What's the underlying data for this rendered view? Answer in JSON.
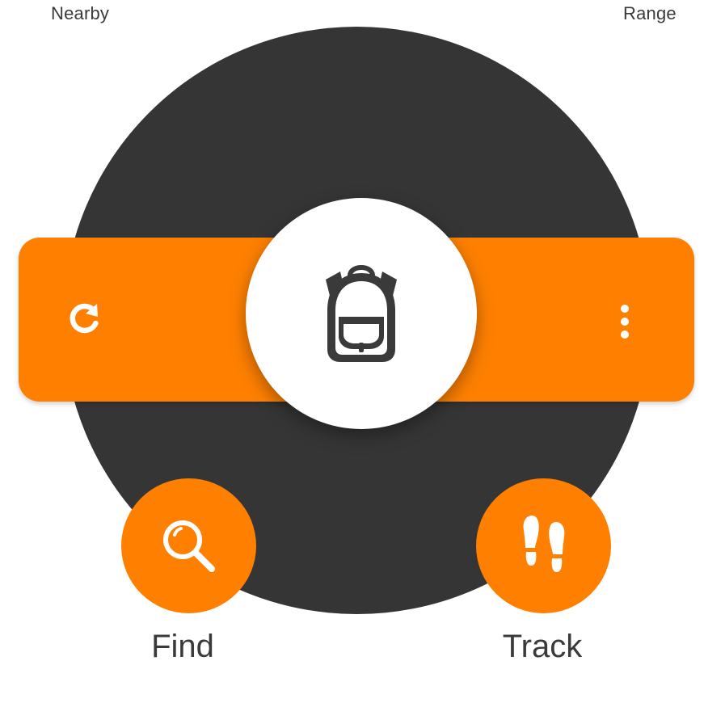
{
  "header": {
    "left_label": "Nearby",
    "right_label": "Range"
  },
  "band": {
    "left_icon": "refresh-icon",
    "right_icon": "more-vertical-icon"
  },
  "center": {
    "icon": "backpack-icon"
  },
  "actions": [
    {
      "label": "Find",
      "icon": "search-icon"
    },
    {
      "label": "Track",
      "icon": "footprints-icon"
    }
  ],
  "colors": {
    "accent": "#ff8000",
    "dial": "#353535",
    "icon_dark": "#3a3a3a",
    "background": "#ffffff"
  }
}
